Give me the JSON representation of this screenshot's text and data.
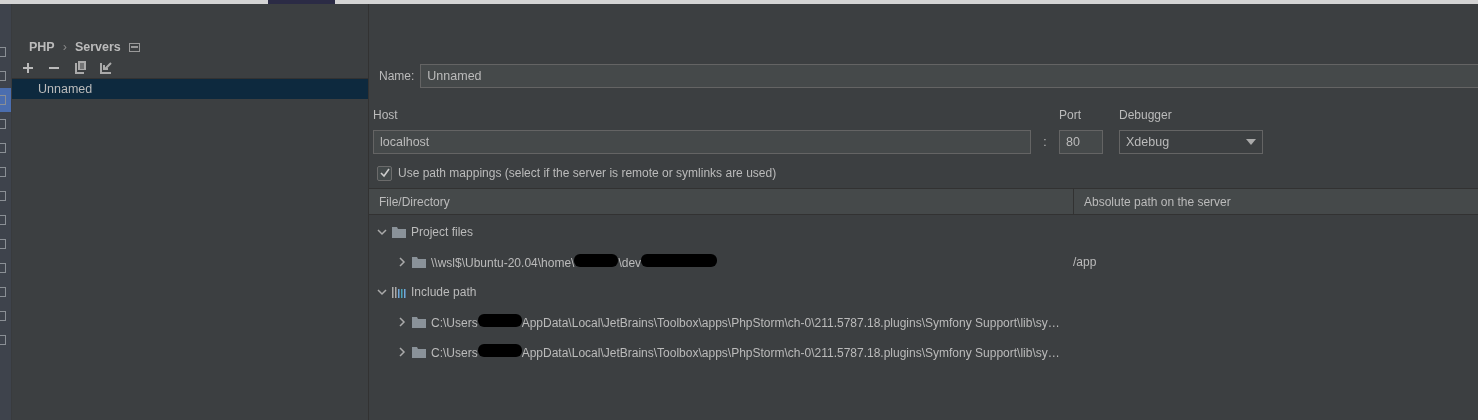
{
  "top_strip": {
    "segments": [
      {
        "selected": false
      },
      {
        "selected": true
      },
      {
        "selected": false
      }
    ]
  },
  "left_strip": {
    "items": [
      {
        "selected": false
      },
      {
        "selected": false
      },
      {
        "selected": true
      },
      {
        "selected": false
      },
      {
        "selected": false
      },
      {
        "selected": false
      },
      {
        "selected": false
      },
      {
        "selected": false
      },
      {
        "selected": false
      },
      {
        "selected": false
      },
      {
        "selected": false
      },
      {
        "selected": false
      },
      {
        "selected": false
      }
    ]
  },
  "breadcrumb": {
    "items": [
      "PHP",
      "Servers"
    ],
    "separator": "›"
  },
  "toolbar": [
    {
      "kind": "add"
    },
    {
      "kind": "remove"
    },
    {
      "kind": "copy"
    },
    {
      "kind": "import"
    }
  ],
  "servers": [
    {
      "label": "Unnamed",
      "selected": true
    }
  ],
  "form": {
    "name_label": "Name:",
    "name_value": "Unnamed",
    "host_label": "Host",
    "host_value": "localhost",
    "port_separator": ":",
    "port_label": "Port",
    "port_value": "80",
    "debugger_label": "Debugger",
    "debugger_value": "Xdebug"
  },
  "path_mappings": {
    "checked": true,
    "label": "Use path mappings (select if the server is remote or symlinks are used)",
    "columns": [
      "File/Directory",
      "Absolute path on the server"
    ],
    "tree": [
      {
        "kind": "folder",
        "expanded": true,
        "parts": [
          {
            "kind": "text",
            "text": "Project files"
          }
        ],
        "children": [
          {
            "kind": "folder",
            "expanded": false,
            "parts": [
              {
                "kind": "text",
                "text": "\\\\wsl$\\Ubuntu-20.04\\home\\"
              },
              {
                "kind": "redacted"
              },
              {
                "kind": "text",
                "text": "\\dev"
              },
              {
                "kind": "redacted_wide"
              }
            ],
            "server_path": "/app"
          }
        ]
      },
      {
        "kind": "library",
        "expanded": true,
        "parts": [
          {
            "kind": "text",
            "text": "Include path"
          }
        ],
        "children": [
          {
            "kind": "folder",
            "expanded": false,
            "parts": [
              {
                "kind": "text",
                "text": "C:\\Users"
              },
              {
                "kind": "redacted"
              },
              {
                "kind": "text",
                "text": "AppData\\Local\\JetBrains\\Toolbox\\apps\\PhpStorm\\ch-0\\211.5787.18.plugins\\Symfony Support\\lib\\sy…"
              }
            ]
          },
          {
            "kind": "folder",
            "expanded": false,
            "parts": [
              {
                "kind": "text",
                "text": "C:\\Users"
              },
              {
                "kind": "redacted"
              },
              {
                "kind": "text",
                "text": "AppData\\Local\\JetBrains\\Toolbox\\apps\\PhpStorm\\ch-0\\211.5787.18.plugins\\Symfony Support\\lib\\sy…"
              }
            ]
          }
        ]
      }
    ]
  }
}
